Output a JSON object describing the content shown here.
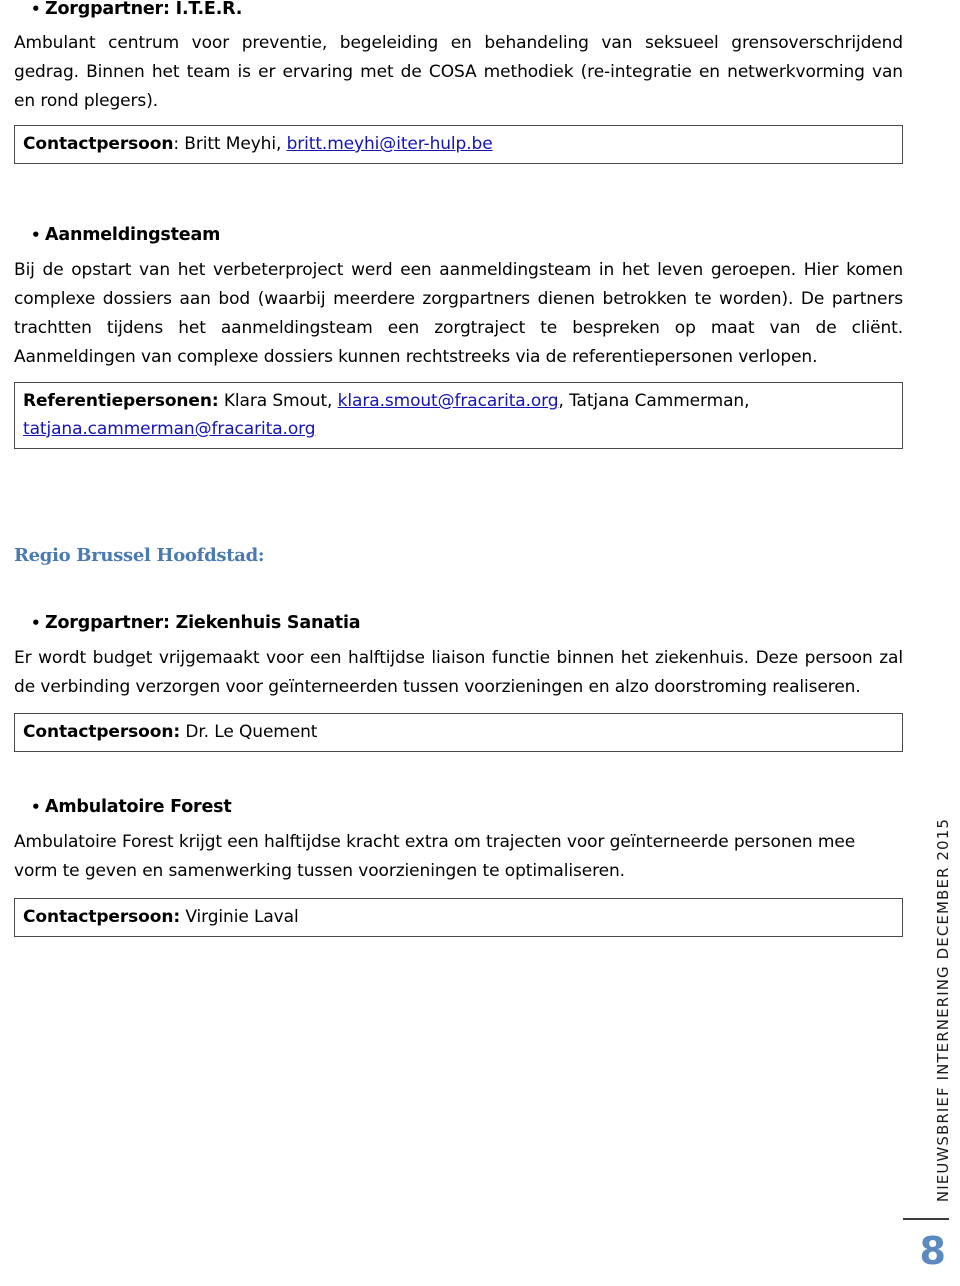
{
  "document": {
    "sections": [
      {
        "id": "iter",
        "heading": "Zorgpartner: I.T.E.R.",
        "bullet": "•",
        "paragraph": "Ambulant centrum voor preventie, begeleiding en behandeling van seksueel grensoverschrijdend gedrag. Binnen het team is er ervaring met de COSA methodiek (re-integratie en netwerkvorming van en rond plegers).",
        "contact": {
          "label": "Contactpersoon",
          "separator": ":",
          "name": " Britt Meyhi, ",
          "email": "britt.meyhi@iter-hulp.be"
        }
      },
      {
        "id": "aanmeldingsteam",
        "heading": "Aanmeldingsteam",
        "bullet": "•",
        "paragraph": "Bij de opstart van het verbeterproject werd een aanmeldingsteam in het leven geroepen. Hier komen complexe dossiers aan bod (waarbij meerdere zorgpartners dienen betrokken te worden). De partners trachtten tijdens het aanmeldingsteam een zorgtraject te bespreken op maat van de cliënt. Aanmeldingen van complexe dossiers kunnen rechtstreeks via de referentiepersonen verlopen.",
        "contact": {
          "label": "Referentiepersonen:",
          "name1": " Klara Smout, ",
          "email1": "klara.smout@fracarita.org",
          "name2": ", Tatjana Cammerman, ",
          "email2": "tatjana.cammerman@fracarita.org"
        }
      }
    ],
    "region_heading": "Regio Brussel Hoofdstad:",
    "region_sections": [
      {
        "id": "sanatia",
        "heading": "Zorgpartner: Ziekenhuis Sanatia",
        "bullet": "•",
        "paragraph": "Er wordt budget vrijgemaakt voor een halftijdse liaison functie binnen het ziekenhuis. Deze persoon zal de verbinding verzorgen voor geïnterneerden tussen voorzieningen en alzo doorstroming realiseren.",
        "contact": {
          "label": "Contactpersoon:",
          "name": " Dr. Le Quement"
        }
      },
      {
        "id": "ambulatoire-forest",
        "heading": "Ambulatoire Forest",
        "bullet": "•",
        "paragraph": "Ambulatoire Forest krijgt een halftijdse kracht extra om trajecten voor geïnterneerde personen mee vorm te geven en samenwerking tussen voorzieningen te optimaliseren.",
        "contact": {
          "label": "Contactpersoon:",
          "name": " Virginie Laval"
        }
      }
    ],
    "running_head": "NIEUWSBRIEF INTERNERING DECEMBER 2015",
    "page_number": "8"
  },
  "colors": {
    "region_heading": "#4a7ab0",
    "page_number": "#5b8ac0",
    "link": "#1414b4",
    "box_border": "#4a4a4a"
  }
}
